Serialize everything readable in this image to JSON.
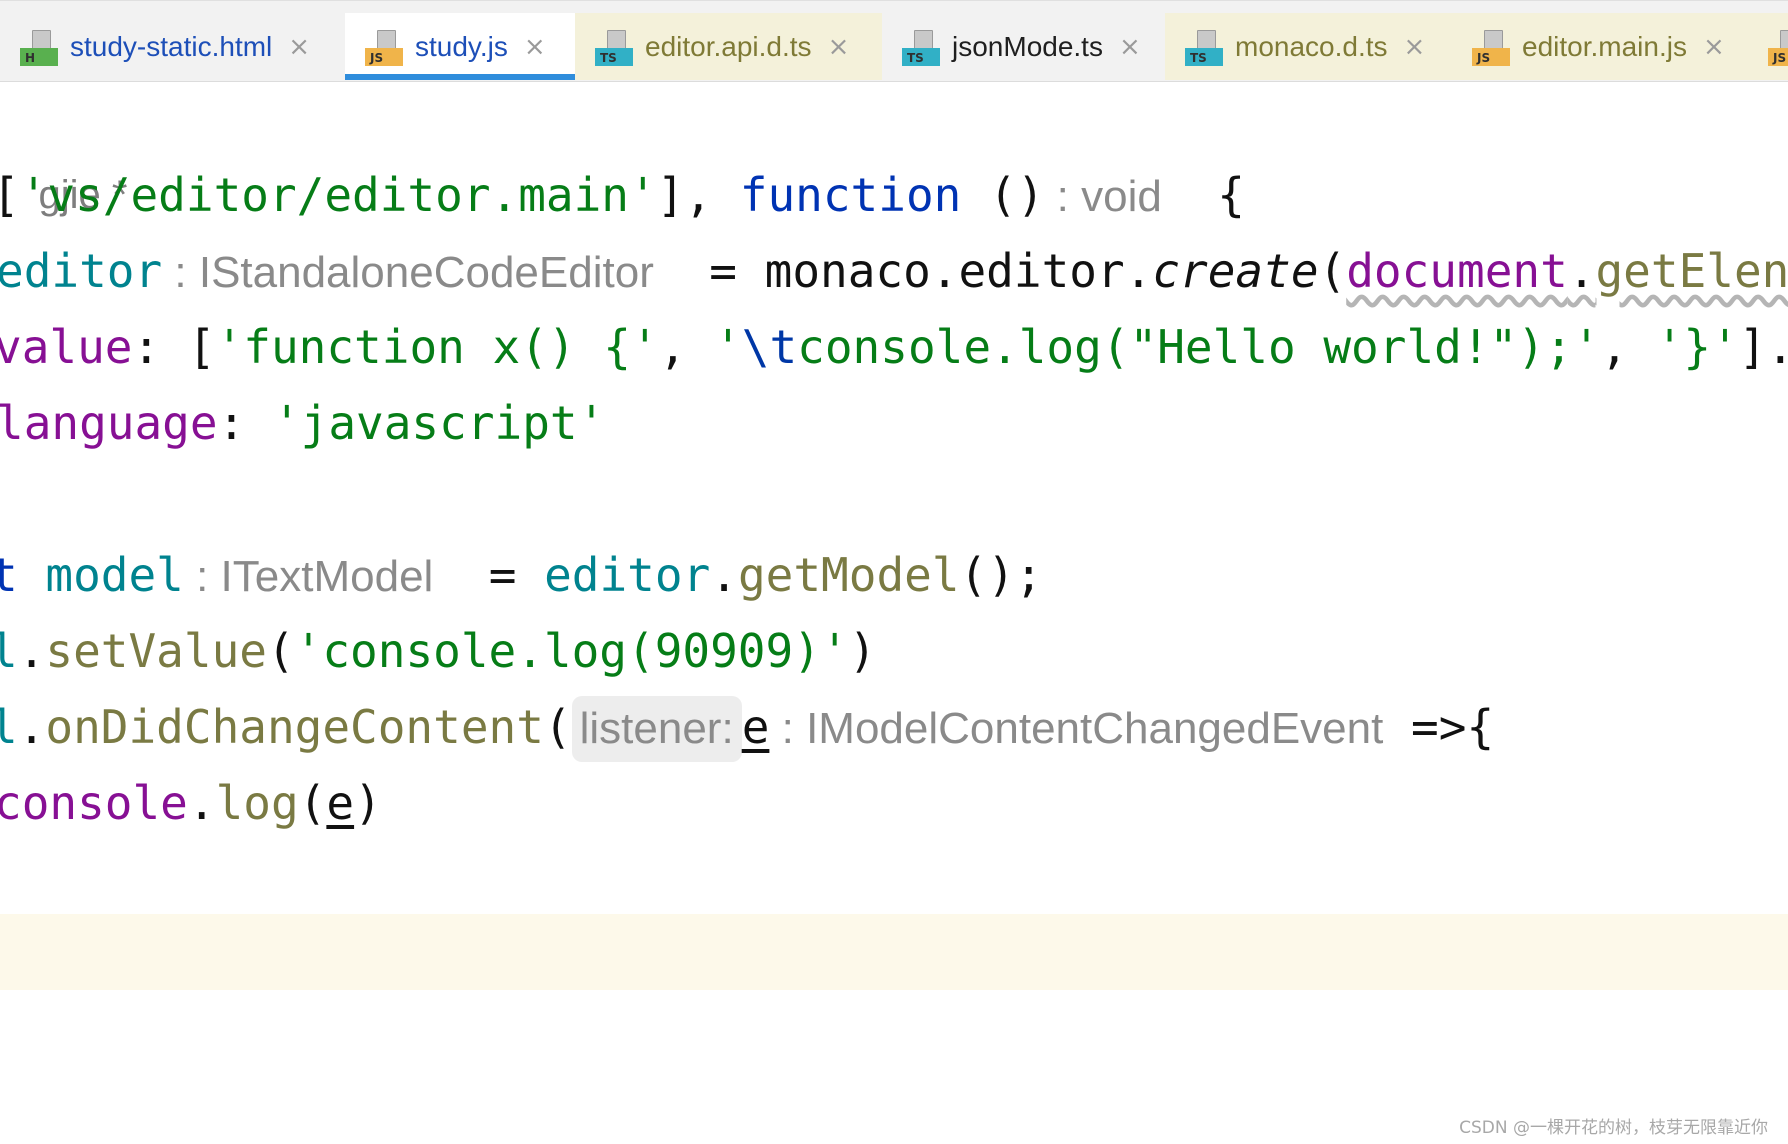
{
  "tabs": [
    {
      "label": "study-static.html",
      "badge": "H",
      "badge_color": "#59b04f",
      "close": "×"
    },
    {
      "label": "study.js",
      "badge": "JS",
      "badge_color": "#f0b44a",
      "close": "×",
      "active": true
    },
    {
      "label": "editor.api.d.ts",
      "badge": "TS",
      "badge_color": "#31b0c6",
      "close": "×"
    },
    {
      "label": "jsonMode.ts",
      "badge": "TS",
      "badge_color": "#31b0c6",
      "close": "×"
    },
    {
      "label": "monaco.d.ts",
      "badge": "TS",
      "badge_color": "#31b0c6",
      "close": "×"
    },
    {
      "label": "editor.main.js",
      "badge": "JS",
      "badge_color": "#f0b44a",
      "close": "×"
    },
    {
      "badge": "JS",
      "badge_color": "#f0b44a"
    }
  ],
  "editor": {
    "author_line": "gjie *",
    "line1": {
      "open": "[",
      "path": "'vs/editor/editor.main'",
      "close": "], ",
      "keyword": "function",
      "parens": " ()",
      "type_hint": " : void",
      "brace": "  {"
    },
    "line2": {
      "var": "editor",
      "type_hint": " : IStandaloneCodeEditor",
      "assign": "  = monaco.editor.",
      "create": "create",
      "paren": "(",
      "document": "document",
      "dot": ".",
      "getel": "getElen"
    },
    "line3": {
      "key": "value",
      "colon": ": [",
      "s1": "'function x() {'",
      "comma1": ", ",
      "s2_open": "'",
      "s2_esc": "\\t",
      "s2_rest": "console.log(\"Hello world!\");'",
      "comma2": ", ",
      "s3": "'}'",
      "end": "]."
    },
    "line4": {
      "key": "language",
      "colon": ": ",
      "value": "'javascript'"
    },
    "line6": {
      "kw": "t ",
      "var": "model",
      "type_hint": " : ITextModel",
      "assign": "  = ",
      "editor": "editor",
      "dot": ".",
      "method": "getModel",
      "end": "();"
    },
    "line7": {
      "obj": "l",
      "dot": ".",
      "method": "setValue",
      "open": "(",
      "str": "'console.log(90909)'",
      "close": ")"
    },
    "line8": {
      "obj": "l",
      "dot": ".",
      "method": "onDidChangeContent",
      "open": "(",
      "param_hint": "listener:",
      "param": "e",
      "type_hint": " : IModelContentChangedEvent",
      "arrow": " =>{"
    },
    "line9": {
      "obj": "console",
      "dot": ".",
      "method": "log",
      "open": "(",
      "arg": "e",
      "close": ")"
    }
  },
  "watermark": "CSDN @一棵开花的树，枝芽无限靠近你"
}
